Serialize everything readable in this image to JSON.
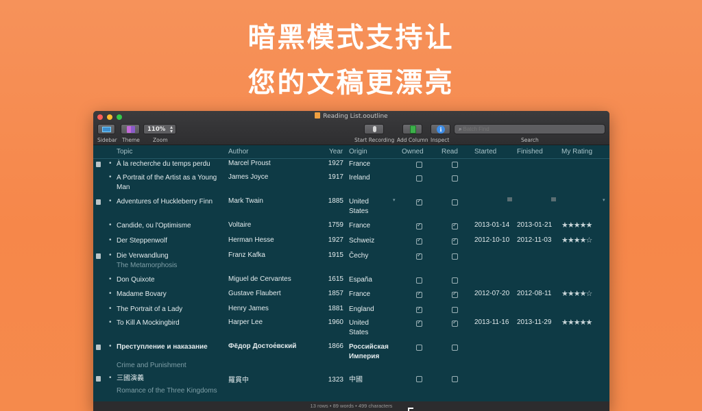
{
  "headline": {
    "line1": "暗黑模式支持让",
    "line2": "您的文稿更漂亮"
  },
  "window": {
    "title": "Reading List.ooutline"
  },
  "toolbar": {
    "sidebar_label": "Sidebar",
    "theme_label": "Theme",
    "zoom_label": "Zoom",
    "zoom_value": "110%",
    "start_recording_label": "Start Recording",
    "add_column_label": "Add Column",
    "inspect_label": "Inspect",
    "search_label": "Search",
    "search_placeholder": "Batch Find"
  },
  "columns": {
    "topic": "Topic",
    "author": "Author",
    "year": "Year",
    "origin": "Origin",
    "owned": "Owned",
    "read": "Read",
    "started": "Started",
    "finished": "Finished",
    "rating": "My Rating"
  },
  "rows": [
    {
      "topic": "À la recherche du temps perdu",
      "author": "Marcel Proust",
      "year": "1927",
      "origin": "France",
      "owned": false,
      "read": false,
      "started": "",
      "finished": "",
      "rating": ""
    },
    {
      "topic": "A Portrait of the Artist as a Young Man",
      "author": "James Joyce",
      "year": "1917",
      "origin": "Ireland",
      "owned": false,
      "read": false,
      "started": "",
      "finished": "",
      "rating": ""
    },
    {
      "topic": "Adventures of Huckleberry Finn",
      "author": "Mark Twain",
      "year": "1885",
      "origin": "United States",
      "owned": true,
      "read": false,
      "started": "",
      "finished": "",
      "rating": ""
    },
    {
      "topic": "Candide, ou l'Optimisme",
      "author": "Voltaire",
      "year": "1759",
      "origin": "France",
      "owned": true,
      "read": true,
      "started": "2013-01-14",
      "finished": "2013-01-21",
      "rating": "★★★★★"
    },
    {
      "topic": "Der Steppenwolf",
      "author": "Herman Hesse",
      "year": "1927",
      "origin": "Schweiz",
      "owned": true,
      "read": true,
      "started": "2012-10-10",
      "finished": "2012-11-03",
      "rating": "★★★★☆"
    },
    {
      "topic": "Die Verwandlung",
      "subtitle": "The Metamorphosis",
      "author": "Franz Kafka",
      "year": "1915",
      "origin": "Čechy",
      "owned": true,
      "read": false,
      "started": "",
      "finished": "",
      "rating": ""
    },
    {
      "topic": "Don Quixote",
      "author": "Miguel de Cervantes",
      "year": "1615",
      "origin": "España",
      "owned": false,
      "read": false,
      "started": "",
      "finished": "",
      "rating": ""
    },
    {
      "topic": "Madame Bovary",
      "author": "Gustave Flaubert",
      "year": "1857",
      "origin": "France",
      "owned": true,
      "read": true,
      "started": "2012-07-20",
      "finished": "2012-08-11",
      "rating": "★★★★☆"
    },
    {
      "topic": "The Portrait of a Lady",
      "author": "Henry James",
      "year": "1881",
      "origin": "England",
      "owned": true,
      "read": false,
      "started": "",
      "finished": "",
      "rating": ""
    },
    {
      "topic": "To Kill A Mockingbird",
      "author": "Harper Lee",
      "year": "1960",
      "origin": "United States",
      "owned": true,
      "read": true,
      "started": "2013-11-16",
      "finished": "2013-11-29",
      "rating": "★★★★★"
    },
    {
      "topic": "Преступление и наказание",
      "subtitle": "Crime and Punishment",
      "author": "Фёдор Достое́вский",
      "year": "1866",
      "origin": "Российская Империя",
      "owned": false,
      "read": false,
      "started": "",
      "finished": "",
      "rating": ""
    },
    {
      "topic": "三國演義",
      "subtitle": "Romance of the Three Kingdoms",
      "author": "羅貫中",
      "year": "1323",
      "origin": "中國",
      "owned": false,
      "read": false,
      "started": "",
      "finished": "",
      "rating": ""
    }
  ],
  "status": {
    "text": "13 rows • 89 words • 499 characters"
  }
}
